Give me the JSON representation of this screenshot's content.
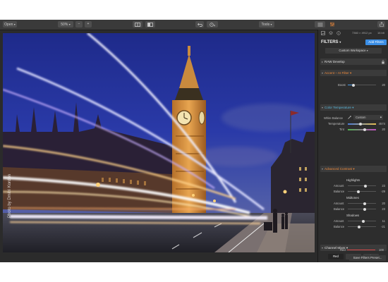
{
  "toolbar": {
    "open_label": "Open",
    "zoom_value": "50%",
    "zoom_out_label": "−",
    "zoom_in_label": "+",
    "tools_label": "Tools"
  },
  "image": {
    "credit": "Photo by Dmitri Kordon"
  },
  "panel": {
    "dimensions": "7360 × 4912 px",
    "bit_depth": "16 bit",
    "filters_title": "FILTERS",
    "add_filters_label": "Add Filters",
    "workspace_label": "Custom Workspace",
    "sections": {
      "raw": "RAW Develop",
      "accent": "Accent – AI Filter",
      "color_temp": "Color Temperature",
      "contrast": "Advanced Contrast",
      "channel": "Channel Mixer"
    },
    "accent": {
      "boost_label": "Boost",
      "boost_value": "20",
      "boost_fraction": 0.2
    },
    "color_temp": {
      "white_balance_label": "White Balance",
      "white_balance_value": "Custom",
      "temperature_label": "Temperature",
      "temperature_value": "4574",
      "temperature_fraction": 0.45,
      "tint_label": "Tint",
      "tint_value": "20",
      "tint_fraction": 0.6
    },
    "contrast": {
      "groups": [
        {
          "title": "Highlights",
          "amount_label": "Amount",
          "amount_value": "23",
          "amount_fraction": 0.62,
          "balance_label": "Balance",
          "balance_value": "-29",
          "balance_fraction": 0.38
        },
        {
          "title": "Midtones",
          "amount_label": "Amount",
          "amount_value": "20",
          "amount_fraction": 0.6,
          "balance_label": "Balance",
          "balance_value": "23",
          "balance_fraction": 0.61
        },
        {
          "title": "Shadows",
          "amount_label": "Amount",
          "amount_value": "11",
          "amount_fraction": 0.55,
          "balance_label": "Balance",
          "balance_value": "-21",
          "balance_fraction": 0.4
        }
      ]
    },
    "channel": {
      "tabs": [
        "Red",
        "Green",
        "Blue"
      ],
      "active_tab": "Red",
      "red_label": "Red",
      "red_value": "100",
      "red_fraction": 1.0
    },
    "save_preset_label": "Save Filters Preset..."
  },
  "colors": {
    "accent_blue": "#4a9be8",
    "section_orange": "#ef8a3c",
    "section_cyan": "#59b6d9"
  }
}
